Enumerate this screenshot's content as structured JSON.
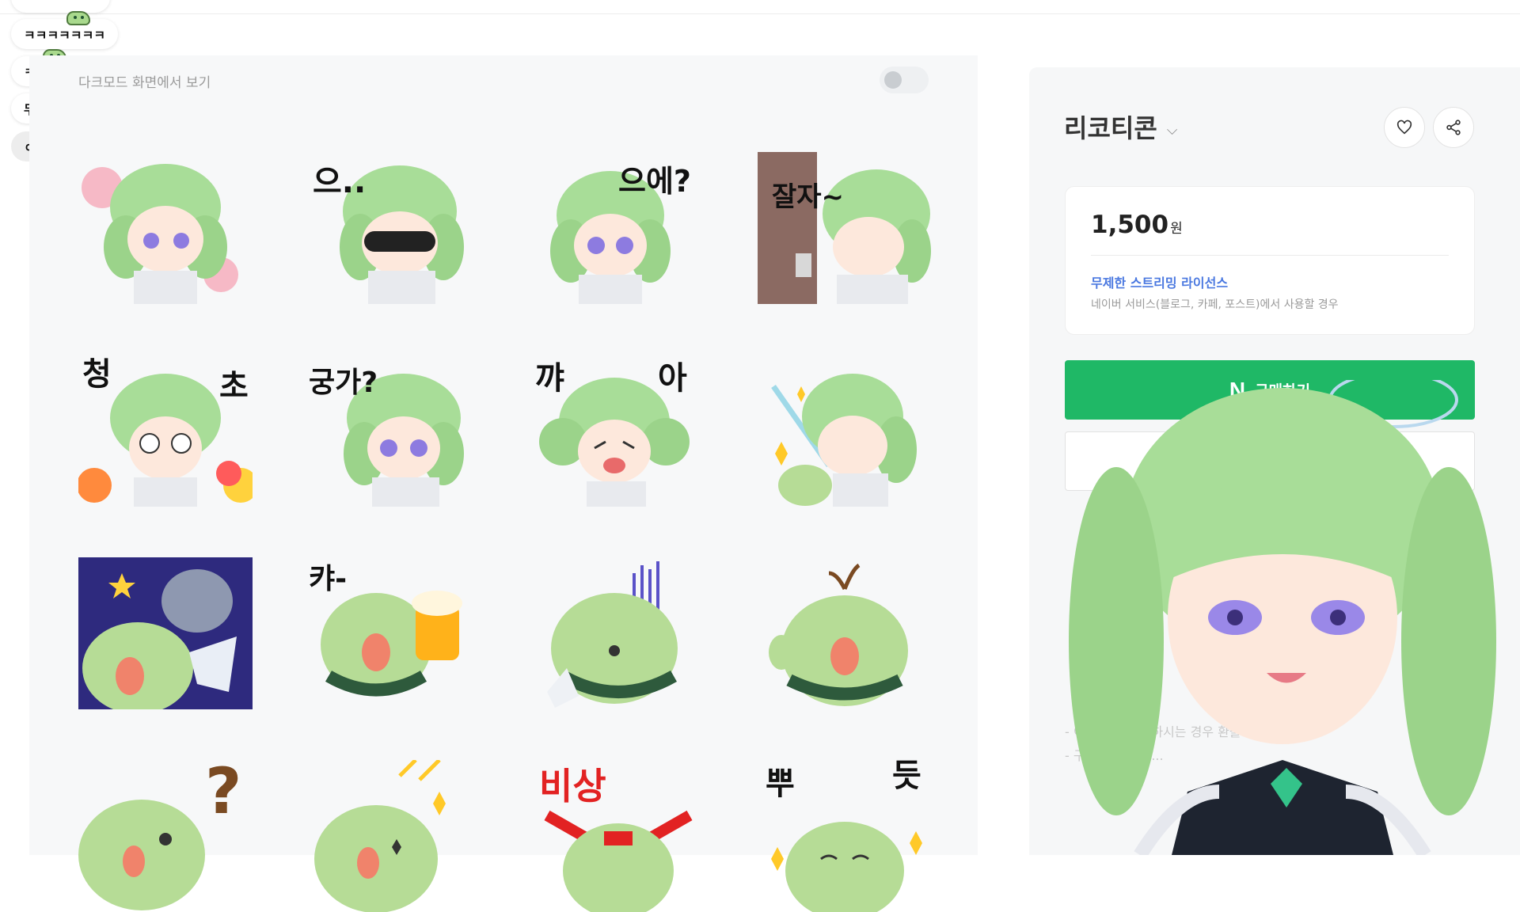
{
  "chat": {
    "messages": [
      "ㅋㅋㅋㅋㅋㅋㅋ",
      "ㅋㅋㅋ",
      "무야",
      "ㅇ우우"
    ]
  },
  "left_panel": {
    "dark_mode_label": "다크모드 화면에서 보기",
    "stickers": [
      {
        "text": ""
      },
      {
        "text": "으.."
      },
      {
        "text": "으에?"
      },
      {
        "text": "잘자~"
      },
      {
        "text": "청"
      },
      {
        "text": "궁가?"
      },
      {
        "text": "꺄"
      },
      {
        "text": ""
      },
      {
        "text": ""
      },
      {
        "text": "캬-"
      },
      {
        "text": ""
      },
      {
        "text": ""
      },
      {
        "text": "?"
      },
      {
        "text": ""
      },
      {
        "text": "비상"
      },
      {
        "text": "뿌"
      }
    ],
    "sticker_extra": {
      "s5_right": "초",
      "s7_right": "아",
      "s15_mid": "|",
      "s16_right": "듯"
    }
  },
  "product": {
    "title": "리코티콘",
    "chevron": "⌵",
    "price": "1,500",
    "price_unit": "원",
    "license_title": "무제한 스트리밍 라이선스",
    "license_desc": "네이버 서비스(블로그, 카페, 포스트)에서 사용할 경우",
    "buy_label": "구매하기",
    "n_logo": "N",
    "notes": [
      "- 이 상품은 사용하시는 경우 환불이 가능합니다.",
      "- 구입한 상품은 ..."
    ]
  },
  "colors": {
    "buy_green": "#1fb866",
    "link_blue": "#4a78e0",
    "sticker_hair": "#a8dd98",
    "hamster": "#b6dc96",
    "scarf": "#2e5a3c"
  },
  "icons": {
    "heart": "heart-icon",
    "share": "share-icon",
    "chevron": "chevron-down-icon"
  }
}
